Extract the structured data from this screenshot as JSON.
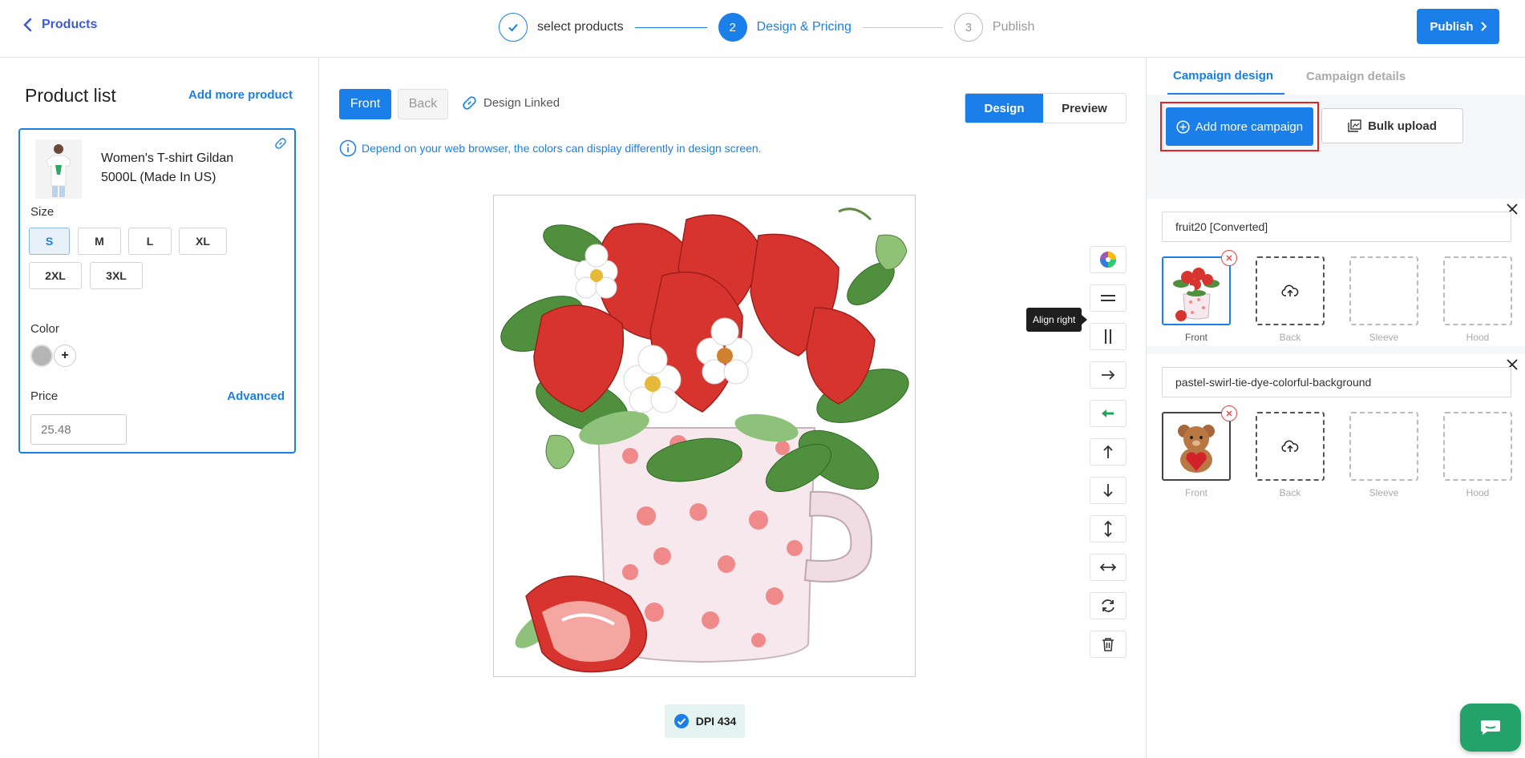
{
  "header": {
    "back_label": "Products",
    "steps": [
      {
        "number": "1",
        "label": "select products",
        "state": "done"
      },
      {
        "number": "2",
        "label": "Design & Pricing",
        "state": "active"
      },
      {
        "number": "3",
        "label": "Publish",
        "state": "todo"
      }
    ],
    "publish_label": "Publish"
  },
  "product_list": {
    "title": "Product list",
    "add_more_label": "Add more product",
    "product": {
      "name": "Women's T-shirt Gildan 5000L (Made In US)",
      "size_label": "Size",
      "sizes": [
        "S",
        "M",
        "L",
        "XL",
        "2XL",
        "3XL"
      ],
      "selected_size": "S",
      "color_label": "Color",
      "color_add": "+",
      "selected_color": "#b5b5b5",
      "price_label": "Price",
      "advanced_label": "Advanced",
      "price_placeholder": "25.48"
    }
  },
  "editor": {
    "front_label": "Front",
    "back_label": "Back",
    "design_linked_label": "Design Linked",
    "design_label": "Design",
    "preview_label": "Preview",
    "notice": "Depend on your web browser, the colors can display differently in design screen.",
    "dpi_label": "DPI 434",
    "tooltip": "Align right",
    "tools": [
      "color-wheel-icon",
      "align-center-horizontal-icon",
      "align-center-vertical-icon",
      "align-right-icon",
      "align-left-icon",
      "align-top-icon",
      "align-bottom-icon",
      "stretch-vertical-icon",
      "stretch-horizontal-icon",
      "rotate-icon",
      "trash-icon"
    ]
  },
  "campaign_panel": {
    "tabs": [
      "Campaign design",
      "Campaign details"
    ],
    "active_tab": "Campaign design",
    "add_campaign_label": "Add more campaign",
    "bulk_upload_label": "Bulk upload",
    "campaigns": [
      {
        "name": "fruit20 [Converted]",
        "slots": [
          "Front",
          "Back",
          "Sleeve",
          "Hood"
        ]
      },
      {
        "name": "pastel-swirl-tie-dye-colorful-background",
        "slots": [
          "Front",
          "Back",
          "Sleeve",
          "Hood"
        ]
      }
    ]
  },
  "colors": {
    "accent": "#1a7fe8",
    "highlight_border": "#e02424",
    "chat": "#23a36a"
  }
}
